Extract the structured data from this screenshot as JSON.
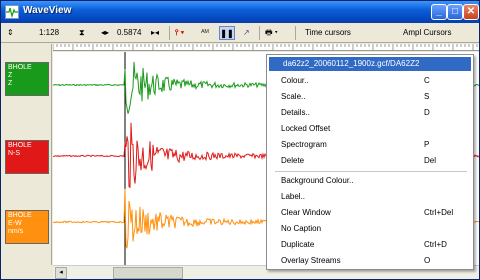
{
  "window": {
    "title": "WaveView"
  },
  "toolbar": {
    "zoom_value": "1:128",
    "width_value": "0.5874",
    "time_cursors": "Time cursors",
    "ampl_cursors": "Ampl Cursors"
  },
  "channels": [
    {
      "lines": [
        "BHOLE",
        "Z",
        "Z"
      ],
      "color": "#1a9a1a"
    },
    {
      "lines": [
        "BHOLE",
        "N-S",
        ""
      ],
      "color": "#e01818"
    },
    {
      "lines": [
        "BHOLE",
        "E-W",
        "nm/s"
      ],
      "color": "#ff9010"
    }
  ],
  "trace_colors": {
    "green": "#1a9a1a",
    "red": "#e01818",
    "orange": "#ff9010"
  },
  "context_menu": {
    "header": "da62z2_20060112_1900z.gcf/DA62Z2",
    "items": [
      {
        "label": "Colour..",
        "shortcut": "C"
      },
      {
        "label": "Scale..",
        "shortcut": "S"
      },
      {
        "label": "Details..",
        "shortcut": "D"
      },
      {
        "label": "Locked Offset",
        "shortcut": ""
      },
      {
        "label": "Spectrogram",
        "shortcut": "P"
      },
      {
        "label": "Delete",
        "shortcut": "Del"
      },
      {
        "label": "Background Colour..",
        "shortcut": ""
      },
      {
        "label": "Label..",
        "shortcut": ""
      },
      {
        "label": "Clear Window",
        "shortcut": "Ctrl+Del"
      },
      {
        "label": "No Caption",
        "shortcut": ""
      },
      {
        "label": "Duplicate",
        "shortcut": "Ctrl+D"
      },
      {
        "label": "Overlay Streams",
        "shortcut": "O"
      }
    ]
  }
}
